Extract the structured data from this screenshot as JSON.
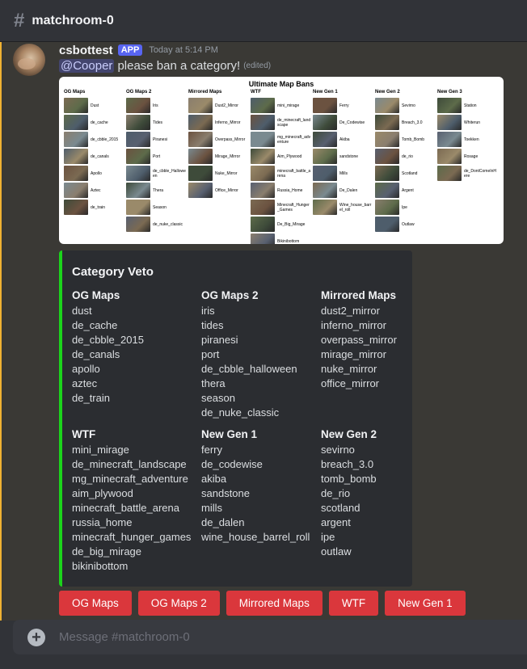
{
  "channel": {
    "name": "matchroom-0",
    "icon": "hash-icon"
  },
  "message": {
    "username": "csbottest",
    "app_tag": "APP",
    "timestamp": "Today at 5:14 PM",
    "mention": "@Cooper",
    "text": "please ban a category!",
    "edited": "(edited)"
  },
  "attachment": {
    "title": "Ultimate Map Bans",
    "columns": [
      {
        "title": "OG Maps",
        "items": [
          "Dust",
          "de_cache",
          "de_cbble_2015",
          "de_canals",
          "Apollo",
          "Aztec",
          "de_train"
        ]
      },
      {
        "title": "OG Maps 2",
        "items": [
          "Iris",
          "Tides",
          "Piranesi",
          "Port",
          "de_cbble_Halloween",
          "Thera",
          "Season",
          "de_nuke_classic"
        ]
      },
      {
        "title": "Mirrored Maps",
        "items": [
          "Dust2_Mirror",
          "Inferno_Mirror",
          "Overpass_Mirror",
          "Mirage_Mirror",
          "Nuke_Mirror",
          "Office_Mirror"
        ]
      },
      {
        "title": "WTF",
        "items": [
          "mini_mirage",
          "de_minecraft_landscape",
          "mg_minecraft_adventure",
          "Aim_Plywood",
          "minecraft_battle_arena",
          "Russia_Home",
          "Minecraft_Hunger_Games",
          "De_Big_Mirage",
          "Bikinibottom"
        ]
      },
      {
        "title": "New Gen 1",
        "items": [
          "Ferry",
          "De_Codewise",
          "Akiba",
          "sandstone",
          "Mills",
          "De_Dalen",
          "Wine_house_barrel_roll"
        ]
      },
      {
        "title": "New Gen 2",
        "items": [
          "Sevirno",
          "Breach_3.0",
          "Tomb_Bomb",
          "de_rio",
          "Scotland",
          "Argent",
          "Ipe",
          "Outlaw"
        ]
      },
      {
        "title": "New Gen 3",
        "items": [
          "Station",
          "Whiterun",
          "Toekken",
          "Rosage",
          "de_DontComeInHere"
        ]
      }
    ]
  },
  "embed": {
    "title": "Category Veto",
    "fields": [
      {
        "name": "OG Maps",
        "value": [
          "dust",
          "de_cache",
          "de_cbble_2015",
          "de_canals",
          "apollo",
          "aztec",
          "de_train"
        ]
      },
      {
        "name": "OG Maps 2",
        "value": [
          "iris",
          "tides",
          "piranesi",
          "port",
          "de_cbble_halloween",
          "thera",
          "season",
          "de_nuke_classic"
        ]
      },
      {
        "name": "Mirrored Maps",
        "value": [
          "dust2_mirror",
          "inferno_mirror",
          "overpass_mirror",
          "mirage_mirror",
          "nuke_mirror",
          "office_mirror"
        ]
      },
      {
        "name": "WTF",
        "value": [
          "mini_mirage",
          "de_minecraft_landscape",
          "mg_minecraft_adventure",
          "aim_plywood",
          "minecraft_battle_arena",
          "russia_home",
          "minecraft_hunger_games",
          "de_big_mirage",
          "bikinibottom"
        ]
      },
      {
        "name": "New Gen 1",
        "value": [
          "ferry",
          "de_codewise",
          "akiba",
          "sandstone",
          "mills",
          "de_dalen",
          "wine_house_barrel_roll"
        ]
      },
      {
        "name": "New Gen 2",
        "value": [
          "sevirno",
          "breach_3.0",
          "tomb_bomb",
          "de_rio",
          "scotland",
          "argent",
          "ipe",
          "outlaw"
        ]
      }
    ]
  },
  "buttons": [
    "OG Maps",
    "OG Maps 2",
    "Mirrored Maps",
    "WTF",
    "New Gen 1"
  ],
  "composer": {
    "placeholder": "Message #matchroom-0"
  },
  "colors": {
    "button": "#da373c",
    "embed_accent": "#1bd41b",
    "mention_bar": "#f0b232",
    "app_tag": "#5865f2"
  }
}
